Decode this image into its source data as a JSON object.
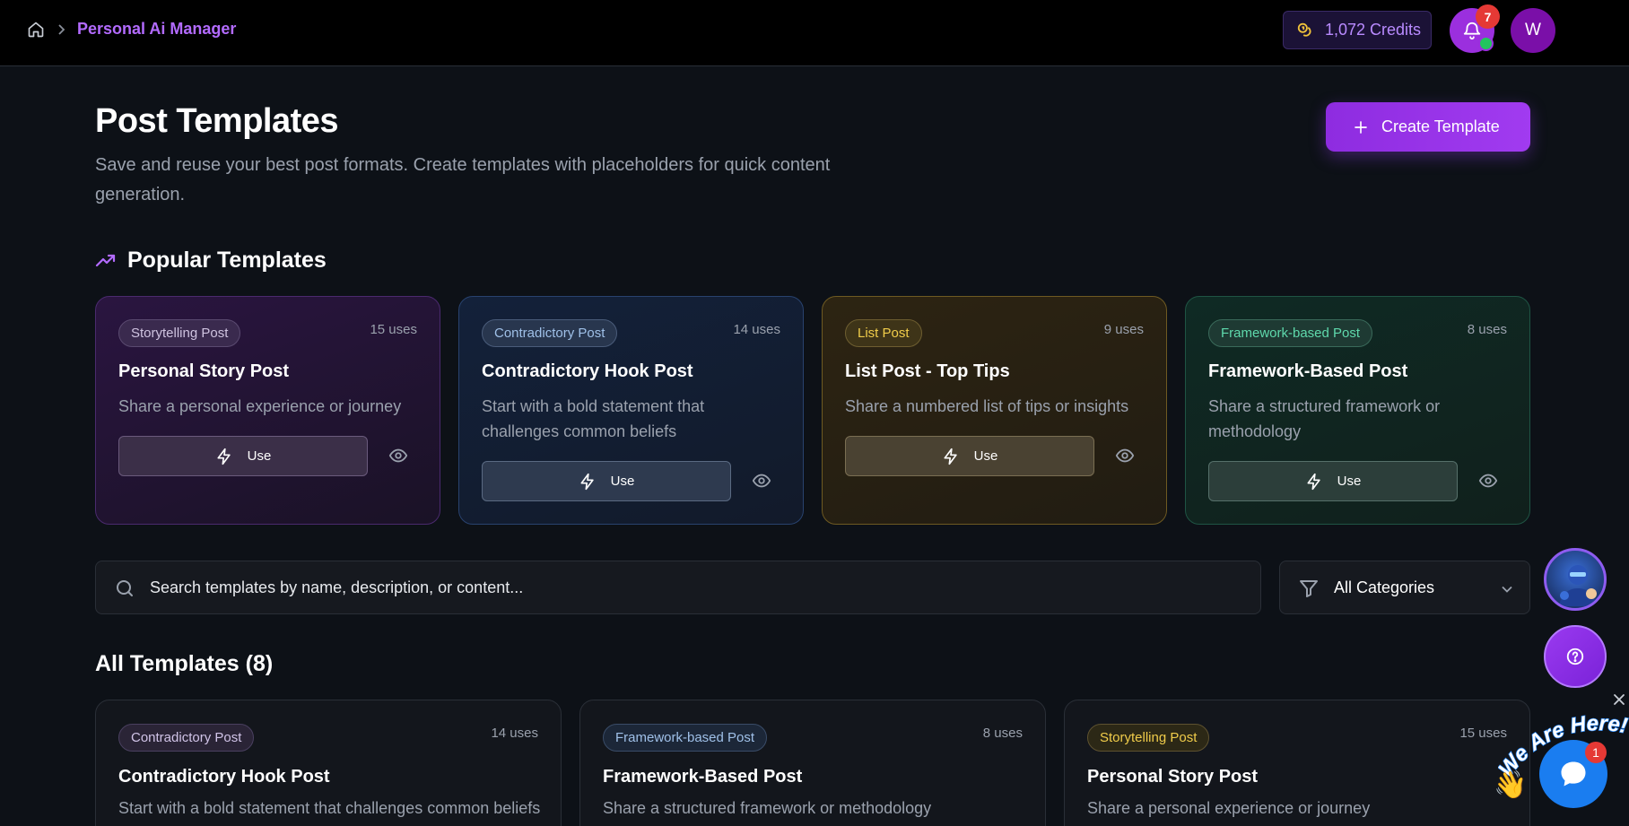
{
  "breadcrumb": {
    "title": "Personal Ai Manager"
  },
  "header": {
    "credits": "1,072 Credits",
    "notifications_count": "7",
    "avatar_initial": "W"
  },
  "page": {
    "title": "Post Templates",
    "subtitle": "Save and reuse your best post formats. Create templates with placeholders for quick content generation.",
    "create_label": "Create Template"
  },
  "popular": {
    "heading": "Popular Templates",
    "cards": [
      {
        "badge": "Storytelling Post",
        "uses": "15 uses",
        "title": "Personal Story Post",
        "desc": "Share a personal experience or journey",
        "use_label": "Use"
      },
      {
        "badge": "Contradictory Post",
        "uses": "14 uses",
        "title": "Contradictory Hook Post",
        "desc": "Start with a bold statement that challenges common beliefs",
        "use_label": "Use"
      },
      {
        "badge": "List Post",
        "uses": "9 uses",
        "title": "List Post - Top Tips",
        "desc": "Share a numbered list of tips or insights",
        "use_label": "Use"
      },
      {
        "badge": "Framework-based Post",
        "uses": "8 uses",
        "title": "Framework-Based Post",
        "desc": "Share a structured framework or methodology",
        "use_label": "Use"
      }
    ]
  },
  "search": {
    "placeholder": "Search templates by name, description, or content..."
  },
  "filter": {
    "selected": "All Categories"
  },
  "all": {
    "heading": "All Templates (8)",
    "cards": [
      {
        "badge": "Contradictory Post",
        "uses": "14 uses",
        "title": "Contradictory Hook Post",
        "desc": "Start with a bold statement that challenges common beliefs"
      },
      {
        "badge": "Framework-based Post",
        "uses": "8 uses",
        "title": "Framework-Based Post",
        "desc": "Share a structured framework or methodology"
      },
      {
        "badge": "Storytelling Post",
        "uses": "15 uses",
        "title": "Personal Story Post",
        "desc": "Share a personal experience or journey"
      }
    ]
  },
  "widgets": {
    "chat_badge": "1",
    "we_are_here": "We Are Here!"
  },
  "icons": [
    "home-icon",
    "chevron-right-icon",
    "coins-icon",
    "bell-icon",
    "plus-icon",
    "trending-up-icon",
    "zap-icon",
    "eye-icon",
    "search-icon",
    "filter-icon",
    "chevron-down-icon",
    "help-icon",
    "chat-icon",
    "close-icon"
  ],
  "colors": {
    "accent": "#9b2fde",
    "brand_text": "#b36bff",
    "chat_blue": "#1a7df0"
  }
}
